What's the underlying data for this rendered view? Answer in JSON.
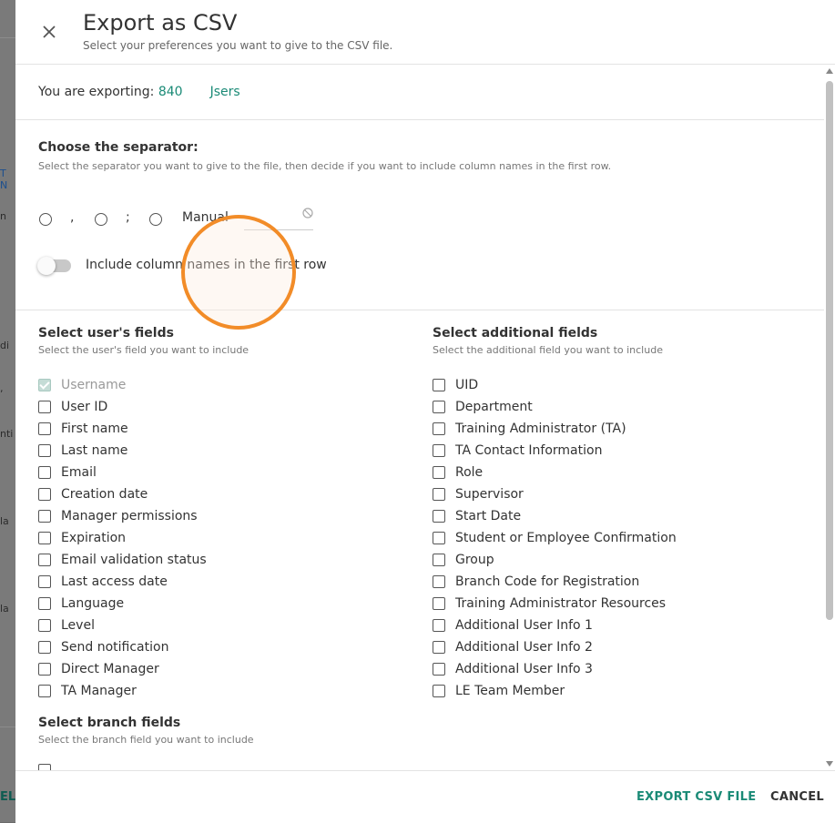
{
  "background": {
    "fragments": [
      "T N",
      "n",
      "di",
      ",",
      "nti",
      "la",
      "la",
      "EL"
    ]
  },
  "dialog": {
    "title": "Export as CSV",
    "subtitle": "Select your preferences you want to give to the CSV file.",
    "close_icon": "close-icon"
  },
  "exporting": {
    "label": "You are exporting: ",
    "count_prefix": "840",
    "count_suffix": "Jsers"
  },
  "separator": {
    "title": "Choose the separator:",
    "subtitle": "Select the separator you want to give to the file, then decide if you want to include column names in the first row.",
    "options": [
      ",",
      ";",
      "Manual"
    ],
    "toggle_label": "Include column names in the first row",
    "toggle_on": false
  },
  "user_fields": {
    "title": "Select user's fields",
    "subtitle": "Select the user's field you want to include",
    "items": [
      {
        "label": "Username",
        "checked": true,
        "disabled": true
      },
      {
        "label": "User ID"
      },
      {
        "label": "First name"
      },
      {
        "label": "Last name"
      },
      {
        "label": "Email"
      },
      {
        "label": "Creation date"
      },
      {
        "label": "Manager permissions"
      },
      {
        "label": "Expiration"
      },
      {
        "label": "Email validation status"
      },
      {
        "label": "Last access date"
      },
      {
        "label": "Language"
      },
      {
        "label": "Level"
      },
      {
        "label": "Send notification"
      },
      {
        "label": "Direct Manager"
      },
      {
        "label": "TA Manager"
      }
    ]
  },
  "additional_fields": {
    "title": "Select additional fields",
    "subtitle": "Select the additional field you want to include",
    "items": [
      {
        "label": "UID"
      },
      {
        "label": "Department"
      },
      {
        "label": "Training Administrator (TA)"
      },
      {
        "label": "TA Contact Information"
      },
      {
        "label": "Role"
      },
      {
        "label": "Supervisor"
      },
      {
        "label": "Start Date"
      },
      {
        "label": "Student or Employee Confirmation"
      },
      {
        "label": "Group"
      },
      {
        "label": "Branch Code for Registration"
      },
      {
        "label": "Training Administrator Resources"
      },
      {
        "label": "Additional User Info 1"
      },
      {
        "label": "Additional User Info 2"
      },
      {
        "label": "Additional User Info 3"
      },
      {
        "label": "LE Team Member"
      }
    ]
  },
  "branch_fields": {
    "title": "Select branch fields",
    "subtitle": "Select the branch field you want to include"
  },
  "footer": {
    "export_label": "EXPORT CSV FILE",
    "cancel_label": "CANCEL"
  },
  "colors": {
    "accent": "#1a8a76",
    "cursor_ring": "#f28c28"
  }
}
